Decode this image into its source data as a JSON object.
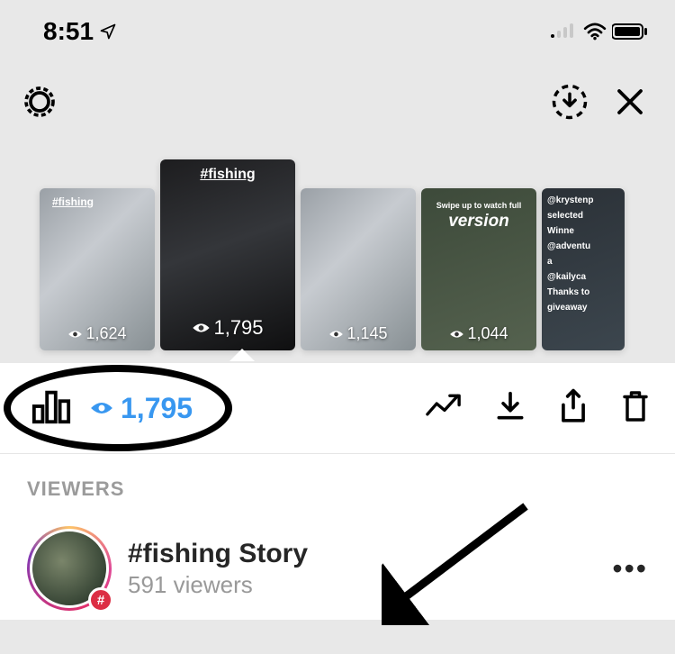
{
  "status": {
    "time": "8:51"
  },
  "stories": [
    {
      "tag": "#fishing",
      "views": "1,624"
    },
    {
      "tag": "#fishing",
      "views": "1,795",
      "selected": true
    },
    {
      "tag": "",
      "views": "1,145"
    },
    {
      "line1": "Swipe up to watch full",
      "line2": "version",
      "views": "1,044"
    },
    {
      "t1": "@krystenp",
      "t2": "selected",
      "t3": "Winne",
      "t4": "@adventu",
      "t5": "a",
      "t6": "@kailyca",
      "t7": "Thanks to",
      "t8": "giveaway"
    }
  ],
  "actionbar": {
    "view_count": "1,795"
  },
  "viewers": {
    "heading": "VIEWERS",
    "row": {
      "title": "#fishing Story",
      "sub": "591 viewers"
    }
  }
}
